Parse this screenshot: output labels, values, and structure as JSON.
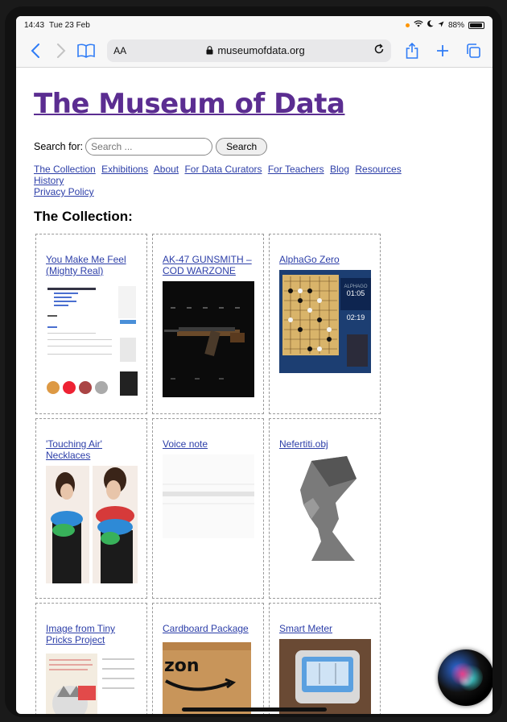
{
  "status_bar": {
    "time": "14:43",
    "date": "Tue 23 Feb",
    "battery": "88%"
  },
  "browser": {
    "text_size_label": "AA",
    "url": "museumofdata.org",
    "icons": [
      "back-icon",
      "forward-icon",
      "bookmarks-icon",
      "lock-icon",
      "reload-icon",
      "share-icon",
      "new-tab-icon",
      "tabs-icon"
    ]
  },
  "page": {
    "title": "The Museum of Data",
    "search_label": "Search for:",
    "search_placeholder": "Search ...",
    "search_button": "Search",
    "nav": [
      "The Collection",
      "Exhibitions",
      "About",
      "For Data Curators",
      "For Teachers",
      "Blog",
      "Resources",
      "History",
      "Privacy Policy"
    ],
    "section_title": "The Collection:",
    "items": [
      {
        "title": "You Make Me Feel (Mighty Real)"
      },
      {
        "title": "AK-47 GUNSMITH – COD WARZONE"
      },
      {
        "title": "AlphaGo Zero"
      },
      {
        "title": "'Touching Air' Necklaces"
      },
      {
        "title": "Voice note"
      },
      {
        "title": "Nefertiti.obj"
      },
      {
        "title": "Image from Tiny Pricks Project"
      },
      {
        "title": "Cardboard Package"
      },
      {
        "title": "Smart Meter"
      }
    ],
    "thumb_text": {
      "alphago_clock_1": "01:05",
      "alphago_clock_2": "02:19",
      "alphago_label": "ALPHAGO",
      "cardboard_text": "zon"
    }
  },
  "colors": {
    "title_purple": "#5b2d91",
    "link_blue": "#2c3ea8",
    "safari_blue": "#2f7cf6"
  }
}
